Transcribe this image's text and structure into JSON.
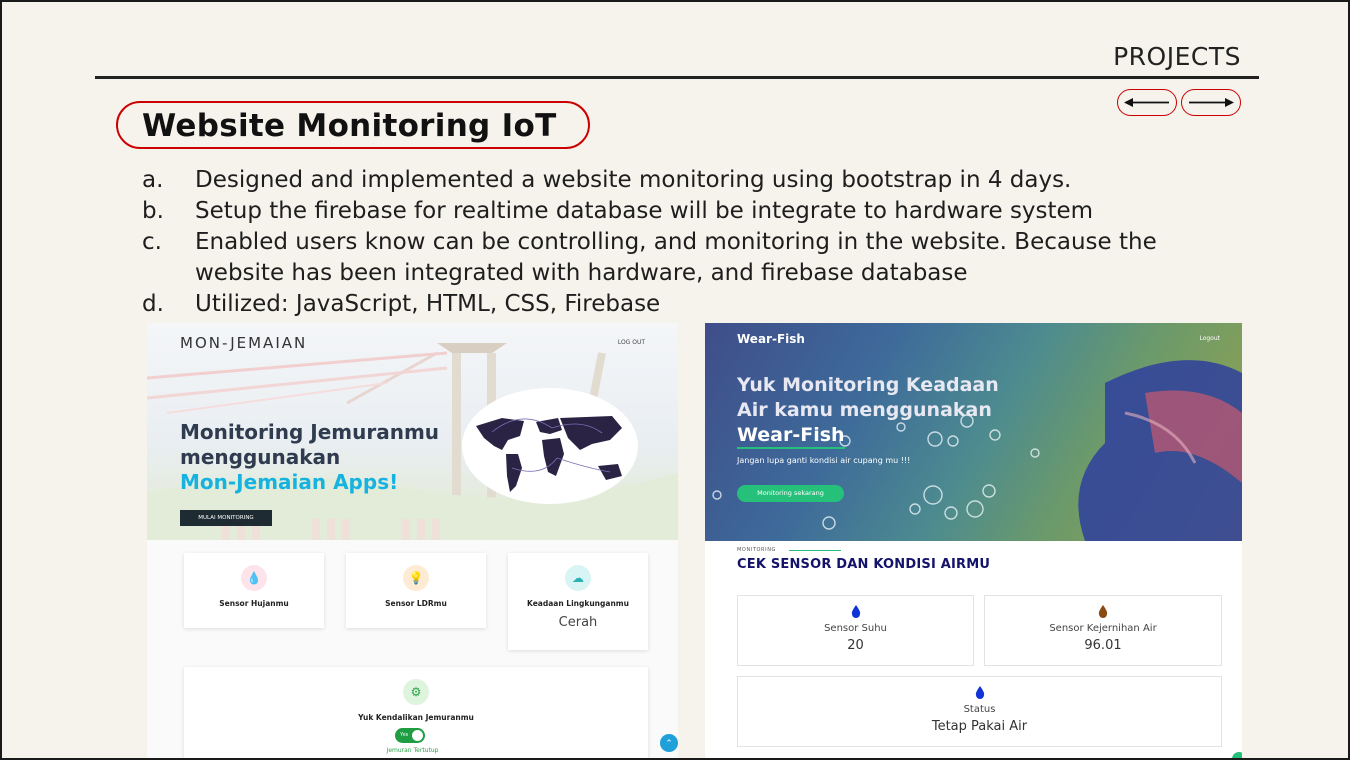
{
  "slide": {
    "section": "PROJECTS",
    "title": "Website Monitoring IoT",
    "bullets": [
      {
        "marker": "a.",
        "text": "Designed and implemented a website monitoring using bootstrap  in 4 days."
      },
      {
        "marker": "b.",
        "text": "Setup the firebase for realtime database will be integrate to hardware system"
      },
      {
        "marker": "c.",
        "text": "Enabled users know can be controlling, and monitoring in the website. Because the website has been integrated with hardware, and firebase database"
      },
      {
        "marker": "d.",
        "text": "Utilized: JavaScript, HTML, CSS, Firebase"
      }
    ],
    "accent_color": "#cc0000"
  },
  "screenshot1": {
    "brand": "MON-JEMAIAN",
    "logout": "LOG OUT",
    "hero_line1": "Monitoring Jemuranmu",
    "hero_line2": "menggunakan",
    "hero_line3": "Mon-Jemaian Apps!",
    "cta": "MULAI MONITORING",
    "cards": [
      {
        "label": "Sensor Hujanmu",
        "icon": "rain-drop-icon"
      },
      {
        "label": "Sensor LDRmu",
        "icon": "bulb-icon"
      },
      {
        "label": "Keadaan Lingkunganmu",
        "value": "Cerah",
        "icon": "cloud-icon"
      }
    ],
    "control_label": "Yuk Kendalikan Jemuranmu",
    "toggle_text": "Yes",
    "toggle_caption": "Jemuran Tertutup",
    "accent_color": "#17b3e0"
  },
  "screenshot2": {
    "brand": "Wear-Fish",
    "logout": "Logout",
    "hero_line1": "Yuk Monitoring Keadaan",
    "hero_line2": "Air kamu menggunakan",
    "hero_line3": "Wear-Fish",
    "hero_sub": "Jangan lupa ganti kondisi air cupang mu !!!",
    "cta": "Monitoring sekarang",
    "kicker": "MONITORING",
    "section_title": "CEK SENSOR DAN KONDISI AIRMU",
    "boxes": [
      {
        "label": "Sensor Suhu",
        "value": "20",
        "icon": "water-drop-icon"
      },
      {
        "label": "Sensor Kejernihan Air",
        "value": "96.01",
        "icon": "water-drop-icon"
      },
      {
        "label": "Status",
        "value": "Tetap Pakai Air",
        "icon": "water-drop-icon"
      }
    ],
    "accent_color": "#25c07a"
  }
}
